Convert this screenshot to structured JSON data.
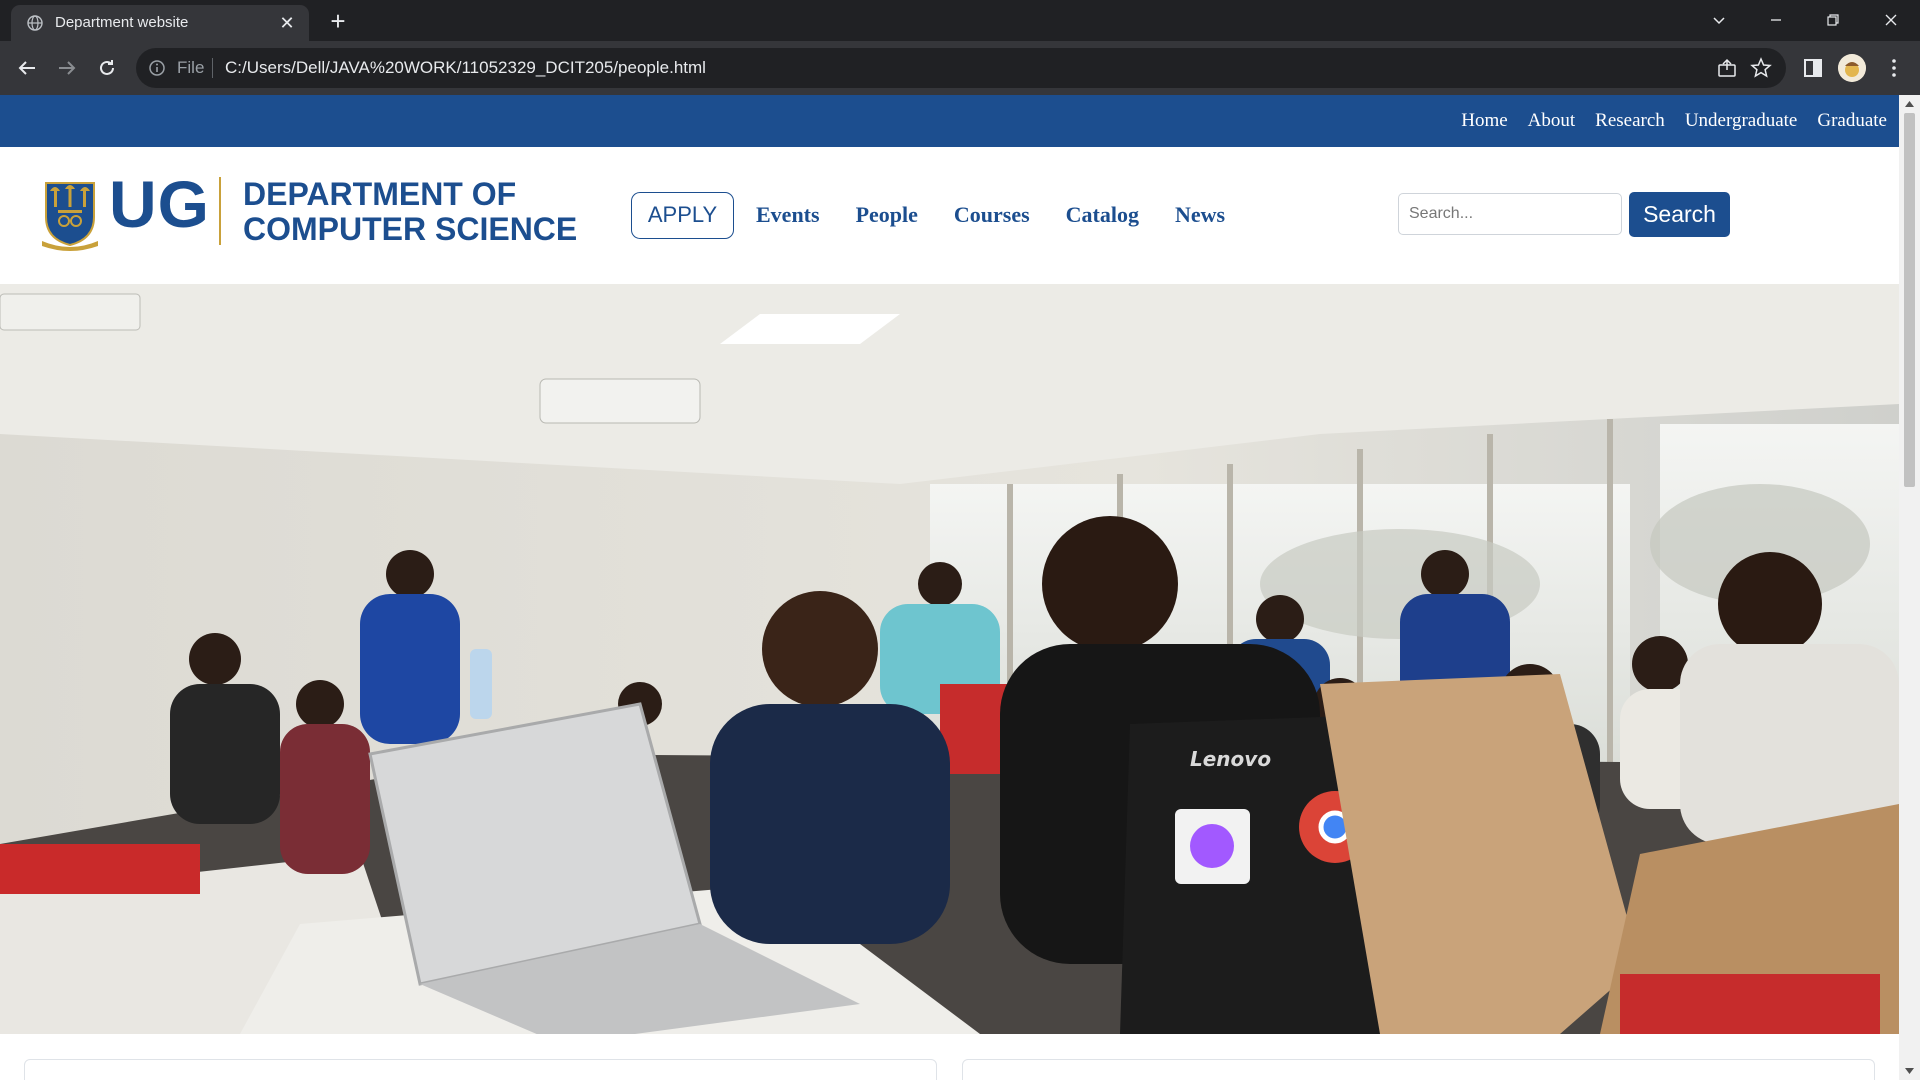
{
  "browser": {
    "tab_title": "Department website",
    "new_tab_symbol": "+",
    "close_symbol": "✕",
    "address_scheme": "File",
    "address_url": "C:/Users/Dell/JAVA%20WORK/11052329_DCIT205/people.html",
    "icons": [
      "globe-icon",
      "back-icon",
      "forward-icon",
      "reload-icon",
      "info-icon",
      "share-icon",
      "star-icon",
      "sidepanel-icon",
      "profile-avatar",
      "menu-icon"
    ]
  },
  "site": {
    "colors": {
      "brand_blue": "#1c4e8f",
      "gold": "#c9a13a"
    },
    "top_nav": [
      "Home",
      "About",
      "Research",
      "Undergraduate",
      "Graduate"
    ],
    "logo": {
      "short": "UG",
      "line1": "DEPARTMENT OF",
      "line2": "COMPUTER SCIENCE"
    },
    "apply_label": "APPLY",
    "main_nav": [
      "Events",
      "People",
      "Courses",
      "Catalog",
      "News"
    ],
    "search": {
      "placeholder": "Search...",
      "button_label": "Search"
    },
    "hero": {
      "laptop_brand": "Lenovo"
    }
  }
}
